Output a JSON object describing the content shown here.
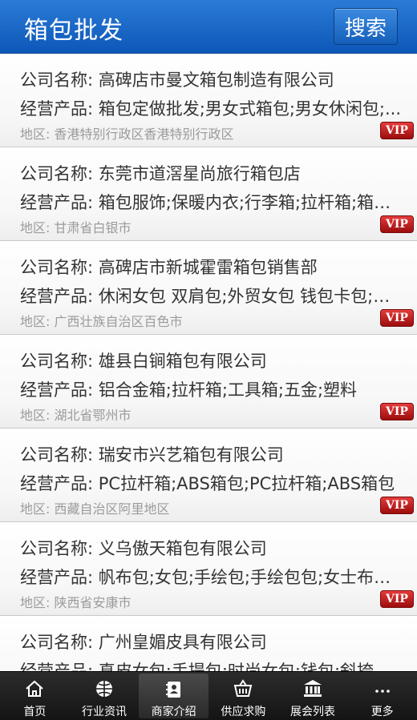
{
  "header": {
    "title": "箱包批发",
    "search_label": "搜索"
  },
  "list": [
    {
      "name": "公司名称: 高碑店市曼文箱包制造有限公司",
      "products": "经营产品: 箱包定做批发;男女式箱包;男女休闲包;...",
      "region": "地区: 香港特别行政区香港特别行政区",
      "badge": "VIP"
    },
    {
      "name": "公司名称: 东莞市道滘星尚旅行箱包店",
      "products": "经营产品: 箱包服饰;保暖内衣;行李箱;拉杆箱;箱包;...",
      "region": "地区: 甘肃省白银市",
      "badge": "VIP"
    },
    {
      "name": "公司名称: 高碑店市新城霍雷箱包销售部",
      "products": "经营产品: 休闲女包 双肩包;外贸女包 钱包卡包;单...",
      "region": "地区: 广西壮族自治区百色市",
      "badge": "VIP"
    },
    {
      "name": "公司名称: 雄县白锏箱包有限公司",
      "products": "经营产品: 铝合金箱;拉杆箱;工具箱;五金;塑料",
      "region": "地区: 湖北省鄂州市",
      "badge": "VIP"
    },
    {
      "name": "公司名称: 瑞安市兴艺箱包有限公司",
      "products": "经营产品: PC拉杆箱;ABS箱包;PC拉杆箱;ABS箱包",
      "region": "地区: 西藏自治区阿里地区",
      "badge": "VIP"
    },
    {
      "name": "公司名称: 义乌傲天箱包有限公司",
      "products": "经营产品: 帆布包;女包;手绘包;手绘包包;女士布包;...",
      "region": "地区: 陕西省安康市",
      "badge": "VIP"
    },
    {
      "name": "公司名称: 广州皇媚皮具有限公司",
      "products": "经营产品: 真皮女包;手提包;时尚女包;钱包;斜挎包;...",
      "region": "",
      "badge": ""
    }
  ],
  "nav": [
    {
      "label": "首页",
      "icon": "home-icon"
    },
    {
      "label": "行业资讯",
      "icon": "globe-icon"
    },
    {
      "label": "商家介绍",
      "icon": "contacts-icon",
      "active": true
    },
    {
      "label": "供应求购",
      "icon": "basket-icon"
    },
    {
      "label": "展会列表",
      "icon": "building-icon"
    },
    {
      "label": "更多",
      "icon": "more-icon"
    }
  ]
}
